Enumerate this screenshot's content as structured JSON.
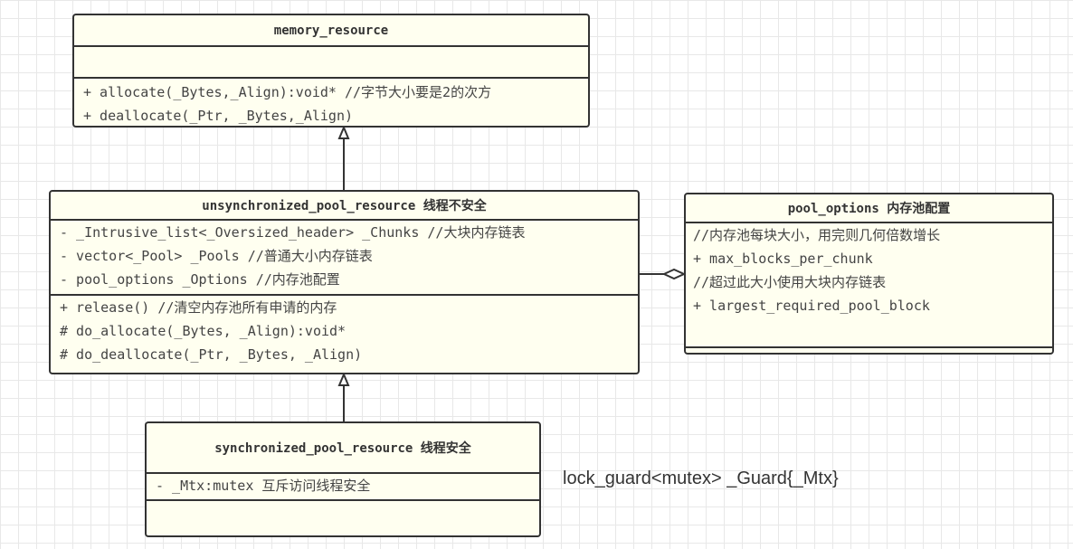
{
  "classes": {
    "memory_resource": {
      "title": "memory_resource",
      "methods": [
        "+ allocate(_Bytes,_Align):void* //字节大小要是2的次方",
        "+ deallocate(_Ptr, _Bytes,_Align)"
      ]
    },
    "unsync": {
      "title": "unsynchronized_pool_resource 线程不安全",
      "attributes": [
        "- _Intrusive_list<_Oversized_header> _Chunks //大块内存链表",
        "- vector<_Pool> _Pools  //普通大小内存链表",
        "- pool_options _Options  //内存池配置"
      ],
      "methods": [
        "+ release() //清空内存池所有申请的内存",
        "# do_allocate(_Bytes, _Align):void*",
        "# do_deallocate(_Ptr, _Bytes, _Align)"
      ]
    },
    "pool_options": {
      "title": "pool_options 内存池配置",
      "attributes": [
        "//内存池每块大小，用完则几何倍数增长",
        "+ max_blocks_per_chunk",
        "//超过此大小使用大块内存链表",
        "+ largest_required_pool_block"
      ]
    },
    "sync": {
      "title": "synchronized_pool_resource 线程安全",
      "attributes": [
        "- _Mtx:mutex  互斥访问线程安全"
      ]
    }
  },
  "note": "lock_guard<mutex> _Guard{_Mtx}",
  "colors": {
    "fill": "#fffff0",
    "stroke": "#333333"
  }
}
